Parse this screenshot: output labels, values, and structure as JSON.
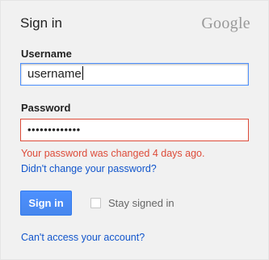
{
  "header": {
    "title": "Sign in",
    "logo": "Google"
  },
  "username": {
    "label": "Username",
    "value": "username"
  },
  "password": {
    "label": "Password",
    "value": "•••••••••••••",
    "error": "Your password was changed 4 days ago.",
    "help_link": "Didn't change your password?"
  },
  "actions": {
    "sign_in": "Sign in",
    "stay_signed_in": "Stay signed in",
    "stay_signed_in_checked": false,
    "recover_link": "Can't access your account?"
  },
  "colors": {
    "accent": "#4d90fe",
    "error": "#dd4b39",
    "link": "#1155cc"
  }
}
